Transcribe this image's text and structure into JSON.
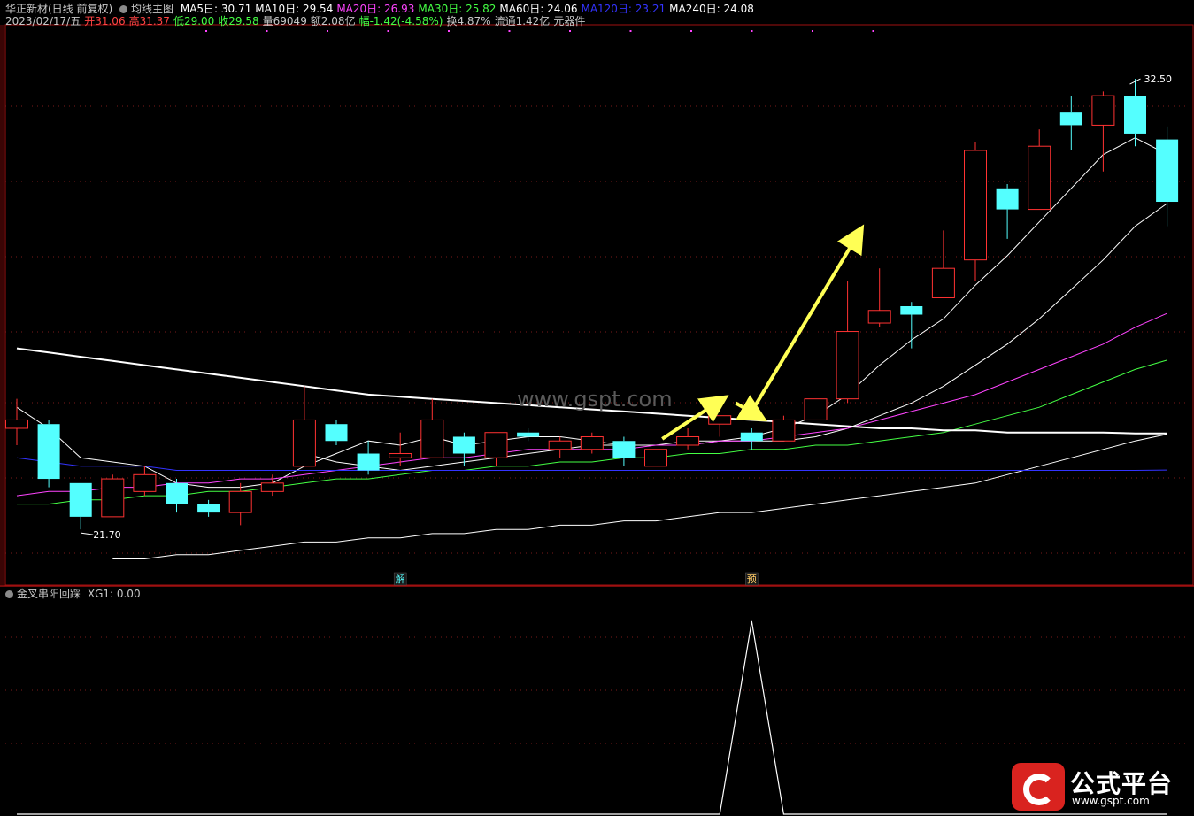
{
  "header": {
    "stock": "华正新材(日线 前复权)",
    "indicator": "均线主图",
    "ma": [
      {
        "label": "MA5日: 30.71",
        "color": "#ffffff"
      },
      {
        "label": "MA10日: 29.54",
        "color": "#ffffff"
      },
      {
        "label": "MA20日: 26.93",
        "color": "#ff44ff"
      },
      {
        "label": "MA30日: 25.82",
        "color": "#44ff44"
      },
      {
        "label": "MA60日: 24.06",
        "color": "#ffffff"
      },
      {
        "label": "MA120日: 23.21",
        "color": "#3333ff"
      },
      {
        "label": "MA240日: 24.08",
        "color": "#ffffff"
      }
    ],
    "quote": [
      {
        "label": "2023/02/17/五",
        "color": "#c8c8c8"
      },
      {
        "label": "开31.06",
        "color": "#ff4444"
      },
      {
        "label": "高31.37",
        "color": "#ff4444"
      },
      {
        "label": "低29.00",
        "color": "#44ff44"
      },
      {
        "label": "收29.58",
        "color": "#44ff44"
      },
      {
        "label": "量69049",
        "color": "#c8c8c8"
      },
      {
        "label": "额2.08亿",
        "color": "#c8c8c8"
      },
      {
        "label": "幅-1.42(-4.58%)",
        "color": "#44ff44"
      },
      {
        "label": "换4.87%",
        "color": "#c8c8c8"
      },
      {
        "label": "流通1.42亿",
        "color": "#c8c8c8"
      },
      {
        "label": "元器件",
        "color": "#c8c8c8"
      }
    ],
    "sub_indicator": "金叉串阳回踩",
    "sub_value": "XG1: 0.00"
  },
  "chart_data": [
    {
      "type": "candlestick",
      "ylim": [
        20.5,
        33.7
      ],
      "max_label": "32.50",
      "min_label": "21.70",
      "markers": [
        {
          "bar": 12,
          "text": "解"
        },
        {
          "bar": 23,
          "text": "预"
        }
      ],
      "bars": [
        {
          "o": 24.2,
          "h": 24.9,
          "l": 23.8,
          "c": 24.4
        },
        {
          "o": 24.3,
          "h": 24.4,
          "l": 22.8,
          "c": 23.0
        },
        {
          "o": 22.9,
          "h": 22.9,
          "l": 21.8,
          "c": 22.1
        },
        {
          "o": 22.1,
          "h": 23.1,
          "l": 22.1,
          "c": 23.0
        },
        {
          "o": 22.7,
          "h": 23.3,
          "l": 22.6,
          "c": 23.1
        },
        {
          "o": 22.9,
          "h": 23.0,
          "l": 22.2,
          "c": 22.4
        },
        {
          "o": 22.4,
          "h": 22.5,
          "l": 22.1,
          "c": 22.2
        },
        {
          "o": 22.2,
          "h": 22.9,
          "l": 21.9,
          "c": 22.7
        },
        {
          "o": 22.7,
          "h": 23.1,
          "l": 22.6,
          "c": 22.9
        },
        {
          "o": 23.3,
          "h": 25.2,
          "l": 23.3,
          "c": 24.4
        },
        {
          "o": 24.3,
          "h": 24.4,
          "l": 23.8,
          "c": 23.9
        },
        {
          "o": 23.6,
          "h": 23.9,
          "l": 23.1,
          "c": 23.2
        },
        {
          "o": 23.5,
          "h": 24.1,
          "l": 23.3,
          "c": 23.6
        },
        {
          "o": 23.5,
          "h": 24.9,
          "l": 23.5,
          "c": 24.4
        },
        {
          "o": 24.0,
          "h": 24.1,
          "l": 23.3,
          "c": 23.6
        },
        {
          "o": 23.5,
          "h": 24.1,
          "l": 23.3,
          "c": 24.1
        },
        {
          "o": 24.1,
          "h": 24.2,
          "l": 23.9,
          "c": 24.0
        },
        {
          "o": 23.7,
          "h": 24.0,
          "l": 23.5,
          "c": 23.9
        },
        {
          "o": 23.7,
          "h": 24.1,
          "l": 23.6,
          "c": 24.0
        },
        {
          "o": 23.9,
          "h": 24.0,
          "l": 23.3,
          "c": 23.5
        },
        {
          "o": 23.3,
          "h": 23.7,
          "l": 23.3,
          "c": 23.7
        },
        {
          "o": 23.8,
          "h": 24.2,
          "l": 23.7,
          "c": 24.0
        },
        {
          "o": 24.3,
          "h": 24.5,
          "l": 24.0,
          "c": 24.5
        },
        {
          "o": 24.1,
          "h": 24.2,
          "l": 23.7,
          "c": 23.9
        },
        {
          "o": 23.9,
          "h": 24.5,
          "l": 23.9,
          "c": 24.4
        },
        {
          "o": 24.4,
          "h": 24.9,
          "l": 24.4,
          "c": 24.9
        },
        {
          "o": 24.9,
          "h": 27.7,
          "l": 24.8,
          "c": 26.5
        },
        {
          "o": 26.7,
          "h": 28.0,
          "l": 26.6,
          "c": 27.0
        },
        {
          "o": 27.1,
          "h": 27.2,
          "l": 26.1,
          "c": 26.9
        },
        {
          "o": 27.3,
          "h": 28.9,
          "l": 27.3,
          "c": 28.0
        },
        {
          "o": 28.2,
          "h": 31.0,
          "l": 27.7,
          "c": 30.8
        },
        {
          "o": 29.9,
          "h": 30.0,
          "l": 28.7,
          "c": 29.4
        },
        {
          "o": 29.4,
          "h": 31.3,
          "l": 29.4,
          "c": 30.9
        },
        {
          "o": 31.7,
          "h": 32.1,
          "l": 30.8,
          "c": 31.4
        },
        {
          "o": 31.4,
          "h": 32.2,
          "l": 30.3,
          "c": 32.1
        },
        {
          "o": 32.1,
          "h": 32.5,
          "l": 30.9,
          "c": 31.2
        },
        {
          "o": 31.06,
          "h": 31.37,
          "l": 29.0,
          "c": 29.58
        }
      ],
      "series": [
        {
          "name": "MA5",
          "color": "#ffffff",
          "width": 1,
          "values": [
            24.7,
            24.2,
            23.5,
            23.4,
            23.3,
            22.9,
            22.8,
            22.8,
            22.9,
            23.3,
            23.6,
            23.9,
            23.8,
            24.0,
            23.8,
            23.9,
            24.0,
            24.0,
            23.9,
            23.8,
            23.8,
            23.9,
            23.9,
            24.0,
            24.2,
            24.5,
            25.0,
            25.7,
            26.3,
            26.8,
            27.6,
            28.3,
            29.1,
            29.9,
            30.7,
            31.1,
            30.71
          ]
        },
        {
          "name": "MA10",
          "color": "#ffffff",
          "width": 1,
          "values": [
            null,
            null,
            null,
            null,
            null,
            null,
            null,
            null,
            null,
            23.6,
            23.4,
            23.3,
            23.2,
            23.3,
            23.4,
            23.5,
            23.6,
            23.7,
            23.8,
            23.8,
            23.8,
            23.8,
            23.9,
            23.9,
            23.9,
            24.0,
            24.2,
            24.5,
            24.8,
            25.2,
            25.7,
            26.2,
            26.8,
            27.5,
            28.2,
            29.0,
            29.54
          ]
        },
        {
          "name": "MA20",
          "color": "#ff44ff",
          "width": 1,
          "values": [
            22.6,
            22.7,
            22.7,
            22.8,
            22.8,
            22.9,
            22.9,
            23.0,
            23.0,
            23.1,
            23.2,
            23.3,
            23.4,
            23.5,
            23.5,
            23.6,
            23.7,
            23.7,
            23.7,
            23.7,
            23.8,
            23.8,
            23.9,
            23.9,
            24.0,
            24.1,
            24.2,
            24.4,
            24.6,
            24.8,
            25.0,
            25.3,
            25.6,
            25.9,
            26.2,
            26.6,
            26.93
          ]
        },
        {
          "name": "MA30",
          "color": "#44ff44",
          "width": 1,
          "values": [
            22.4,
            22.4,
            22.5,
            22.5,
            22.6,
            22.6,
            22.7,
            22.7,
            22.8,
            22.9,
            23.0,
            23.0,
            23.1,
            23.2,
            23.2,
            23.3,
            23.3,
            23.4,
            23.4,
            23.5,
            23.5,
            23.6,
            23.6,
            23.7,
            23.7,
            23.8,
            23.8,
            23.9,
            24.0,
            24.1,
            24.3,
            24.5,
            24.7,
            25.0,
            25.3,
            25.6,
            25.82
          ]
        },
        {
          "name": "MA60",
          "color": "#ffffff",
          "width": 1,
          "values": [
            null,
            null,
            null,
            21.1,
            21.1,
            21.2,
            21.2,
            21.3,
            21.4,
            21.5,
            21.5,
            21.6,
            21.6,
            21.7,
            21.7,
            21.8,
            21.8,
            21.9,
            21.9,
            22.0,
            22.0,
            22.1,
            22.2,
            22.2,
            22.3,
            22.4,
            22.5,
            22.6,
            22.7,
            22.8,
            22.9,
            23.1,
            23.3,
            23.5,
            23.7,
            23.9,
            24.06
          ]
        },
        {
          "name": "MA120",
          "color": "#3333ff",
          "width": 1,
          "values": [
            23.5,
            23.4,
            23.3,
            23.3,
            23.3,
            23.2,
            23.2,
            23.2,
            23.2,
            23.2,
            23.2,
            23.2,
            23.2,
            23.2,
            23.2,
            23.2,
            23.2,
            23.2,
            23.2,
            23.2,
            23.2,
            23.2,
            23.2,
            23.2,
            23.2,
            23.2,
            23.2,
            23.2,
            23.2,
            23.2,
            23.2,
            23.2,
            23.2,
            23.2,
            23.2,
            23.2,
            23.21
          ]
        },
        {
          "name": "MA240",
          "color": "#ffffff",
          "width": 2,
          "values": [
            26.1,
            26.0,
            25.9,
            25.8,
            25.7,
            25.6,
            25.5,
            25.4,
            25.3,
            25.2,
            25.1,
            25.0,
            24.95,
            24.9,
            24.85,
            24.8,
            24.75,
            24.7,
            24.65,
            24.6,
            24.55,
            24.5,
            24.45,
            24.4,
            24.35,
            24.3,
            24.25,
            24.2,
            24.2,
            24.15,
            24.15,
            24.1,
            24.1,
            24.1,
            24.1,
            24.08,
            24.08
          ]
        }
      ],
      "annotations": [
        {
          "type": "arrow",
          "from": [
            20.2,
            23.95
          ],
          "to": [
            22.1,
            24.9
          ],
          "color": "#ffff55"
        },
        {
          "type": "arrow",
          "from": [
            22.5,
            24.8
          ],
          "to": [
            23.3,
            24.45
          ],
          "color": "#ffff55"
        },
        {
          "type": "arrow",
          "from": [
            23.0,
            24.6
          ],
          "to": [
            26.4,
            28.9
          ],
          "color": "#ffff55"
        }
      ]
    },
    {
      "type": "line",
      "ylim": [
        0,
        1.1
      ],
      "values": [
        0,
        0,
        0,
        0,
        0,
        0,
        0,
        0,
        0,
        0,
        0,
        0,
        0,
        0,
        0,
        0,
        0,
        0,
        0,
        0,
        0,
        0,
        0,
        1,
        0,
        0,
        0,
        0,
        0,
        0,
        0,
        0,
        0,
        0,
        0,
        0,
        0
      ]
    }
  ],
  "watermark": "www.gspt.com",
  "logo": {
    "title": "公式平台",
    "url": "www.gspt.com"
  }
}
